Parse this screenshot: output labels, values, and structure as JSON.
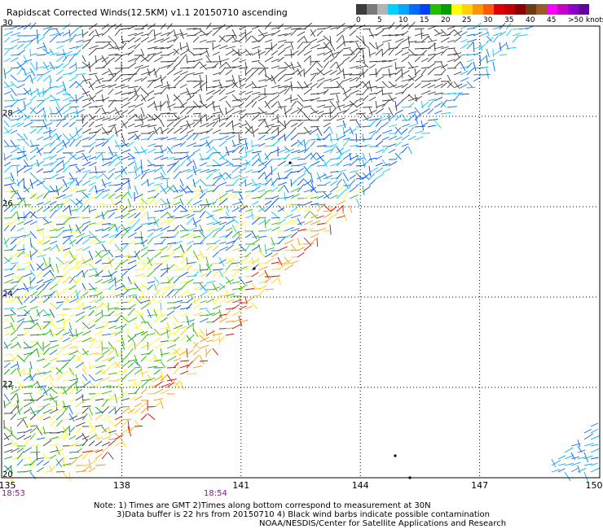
{
  "title": "Rapidscat Corrected Winds(12.5KM) v1.1 20150710 ascending",
  "legend": {
    "colors": [
      "#3c3c3c",
      "#7a7a7a",
      "#b4b4b4",
      "#00d2ff",
      "#00a8ff",
      "#006cff",
      "#0040ff",
      "#20c000",
      "#00a000",
      "#ffff00",
      "#ffd200",
      "#ff9600",
      "#ff5a00",
      "#e00000",
      "#c00000",
      "#8a0000",
      "#6e3c14",
      "#9b5a2a",
      "#ff00ff",
      "#c800c8",
      "#8c00c8",
      "#6400a0"
    ],
    "labels": [
      "0",
      "5",
      "10",
      "15",
      "20",
      "25",
      "30",
      "35",
      "40",
      "45",
      ">50 knots"
    ]
  },
  "map": {
    "lon_range": [
      135,
      150
    ],
    "lat_range": [
      20,
      30
    ],
    "lon_ticks": [
      "135",
      "138",
      "141",
      "144",
      "147",
      "150"
    ],
    "lat_ticks": [
      "30",
      "28",
      "26",
      "24",
      "22",
      "20"
    ],
    "grid": true,
    "swath": "diagonal ascending pass covering the upper-left triangle of the map"
  },
  "times": [
    "18:53",
    "18:54"
  ],
  "notes": [
    "Note: 1) Times are GMT 2)Times along bottom correspond to measurement at 30N",
    "3)Data buffer is 22 hrs from 20150710 4) Black wind barbs indicate possible contamination",
    "NOAA/NESDIS/Center for Satellite Applications and Research"
  ]
}
